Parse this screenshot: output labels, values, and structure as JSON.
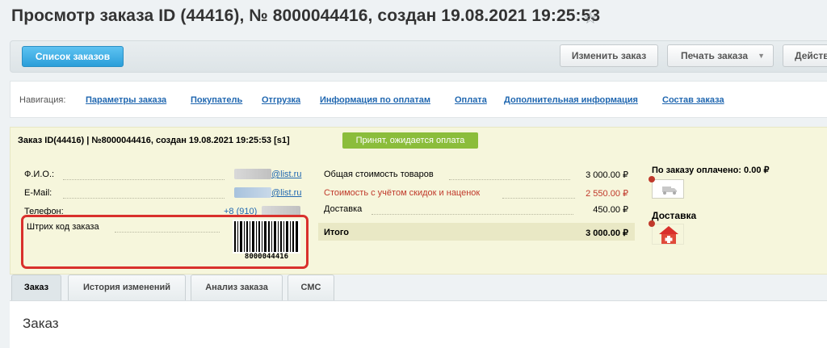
{
  "header": {
    "title": "Просмотр заказа ID (44416), № 8000044416, создан 19.08.2021 19:25:53"
  },
  "toolbar": {
    "list_button": "Список заказов",
    "edit_button": "Изменить заказ",
    "print_button": "Печать заказа",
    "actions_button": "Действия"
  },
  "nav": {
    "label": "Навигация:",
    "links": [
      "Параметры заказа",
      "Покупатель",
      "Отгрузка",
      "Информация по оплатам",
      "Оплата",
      "Дополнительная информация",
      "Состав заказа"
    ]
  },
  "order": {
    "heading": "Заказ ID(44416) | №8000044416, создан 19.08.2021 19:25:53 [s1]",
    "status": "Принят, ожидается оплата",
    "status_color": "#8bbd3b"
  },
  "buyer": {
    "name_label": "Ф.И.О.:",
    "email_label": "E-Mail:",
    "email_domain_1": "@list.ru",
    "email_domain_2": "@list.ru",
    "phone_label": "Телефон:",
    "phone_value": "+8 (910)",
    "barcode_label": "Штрих код заказа",
    "barcode_number": "8000044416"
  },
  "totals": {
    "goods_label": "Общая стоимость товаров",
    "goods_value": "3 000.00 ₽",
    "discount_label": "Стоимость с учётом скидок и наценок",
    "discount_value": "2 550.00 ₽",
    "delivery_label": "Доставка",
    "delivery_value": "450.00 ₽",
    "total_label": "Итого",
    "total_value": "3 000.00 ₽",
    "discount_color": "#c0392b"
  },
  "side": {
    "paid_label": "По заказу оплачено: 0.00 ₽",
    "delivery_label": "Доставка",
    "paid_icon": "truck-icon",
    "delivery_icon": "house-plus-icon"
  },
  "tabs": [
    "Заказ",
    "История изменений",
    "Анализ заказа",
    "СМС"
  ],
  "section": {
    "title": "Заказ"
  }
}
